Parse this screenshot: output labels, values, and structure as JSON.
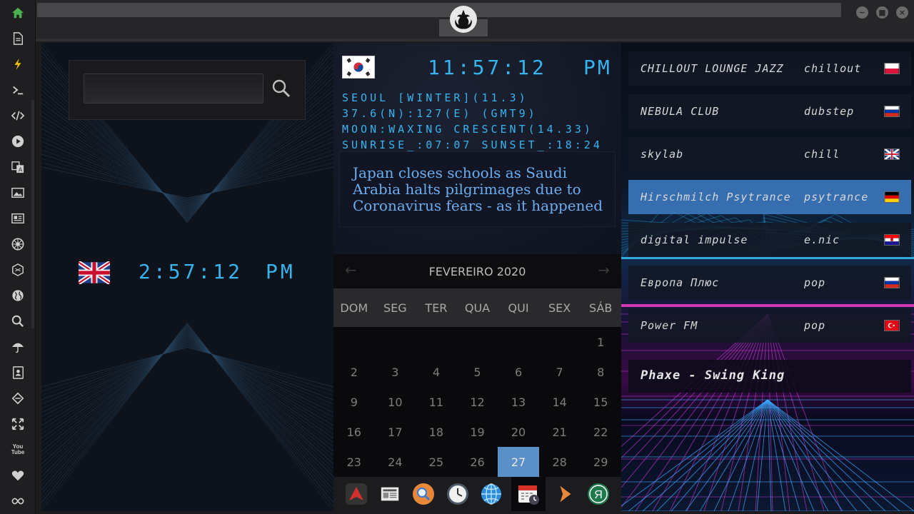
{
  "sidebar": {
    "items": [
      {
        "name": "home-icon",
        "color": "#4caf50"
      },
      {
        "name": "document-icon"
      },
      {
        "name": "lightning-icon",
        "color": "#f2c200"
      },
      {
        "name": "terminal-icon"
      },
      {
        "name": "code-icon"
      },
      {
        "name": "play-icon"
      },
      {
        "name": "translate-icon"
      },
      {
        "name": "image-icon"
      },
      {
        "name": "news-icon"
      },
      {
        "name": "empire-icon"
      },
      {
        "name": "hexagon-icon"
      },
      {
        "name": "globe-icon"
      },
      {
        "name": "search-icon"
      },
      {
        "name": "umbrella-icon"
      },
      {
        "name": "contacts-icon"
      },
      {
        "name": "codepen-icon"
      },
      {
        "name": "expand-icon"
      },
      {
        "name": "youtube-icon"
      },
      {
        "name": "heart-icon"
      },
      {
        "name": "infinity-icon"
      }
    ],
    "youtube_label": "You Tube"
  },
  "search": {
    "value": "",
    "placeholder": ""
  },
  "clock_uk": {
    "time": "2:57:12",
    "ampm": "PM"
  },
  "clock_seoul": {
    "time": "11:57:12",
    "ampm": "PM",
    "lines": [
      "SEOUL [WINTER](11.3)",
      "37.6(N):127(E) (GMT9)",
      "MOON:WAXING CRESCENT(14.33)",
      "SUNRISE_:07:07 SUNSET_:18:24"
    ]
  },
  "news": {
    "headline": "Japan closes schools as Saudi Arabia halts pilgrimages due to Coronavirus fears - as it happened"
  },
  "calendar": {
    "title": "FEVEREIRO 2020",
    "weekdays": [
      "DOM",
      "SEG",
      "TER",
      "QUA",
      "QUI",
      "SEX",
      "SÁB"
    ],
    "today": 27,
    "first_weekday_index": 6,
    "days_shown": 29,
    "highlight_color": "#5b8fc8"
  },
  "dock": {
    "items": [
      "app-launcher-icon",
      "newspaper-icon",
      "search-icon",
      "clock-icon",
      "globe-icon",
      "calendar-icon",
      "play-arrow-icon",
      "yandex-icon"
    ],
    "active": "calendar-icon",
    "yandex_letter": "Я"
  },
  "radio": {
    "stations": [
      {
        "name": "CHILLOUT LOUNGE JAZZ",
        "genre": "chillout",
        "flag": "poland"
      },
      {
        "name": "NEBULA CLUB",
        "genre": "dubstep",
        "flag": "russia"
      },
      {
        "name": "skylab",
        "genre": "chill",
        "flag": "uk"
      },
      {
        "name": "Hirschmilch Psytrance",
        "genre": "psytrance",
        "flag": "germany"
      },
      {
        "name": "digital impulse",
        "genre": "e.nic",
        "flag": "croatia"
      },
      {
        "name": "Европа Плюс",
        "genre": "pop",
        "flag": "russia"
      },
      {
        "name": "Power FM",
        "genre": "pop",
        "flag": "turkey"
      }
    ],
    "active_index": 3,
    "now_playing": "Phaxe - Swing King"
  }
}
